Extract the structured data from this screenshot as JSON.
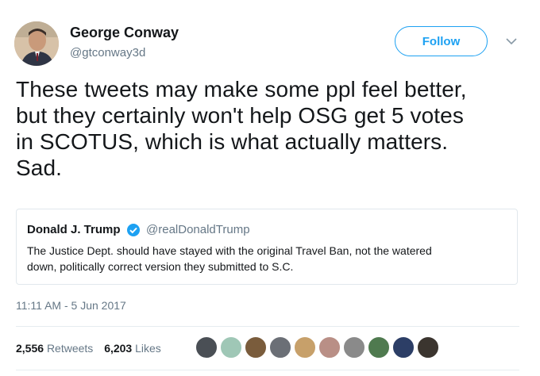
{
  "author": {
    "name": "George Conway",
    "handle": "@gtconway3d"
  },
  "follow_label": "Follow",
  "tweet": {
    "lines": [
      "These tweets may make some ppl feel better,",
      "but they certainly won't help OSG get 5 votes",
      "in SCOTUS, which is what actually matters.",
      "Sad."
    ]
  },
  "quoted": {
    "name": "Donald J. Trump",
    "handle": "@realDonaldTrump",
    "lines": [
      "The Justice Dept. should have stayed with the original Travel Ban, not the watered",
      "down, politically correct version they submitted to S.C."
    ]
  },
  "timestamp": "11:11 AM - 5 Jun 2017",
  "stats": {
    "retweets_count": "2,556",
    "retweets_label": "Retweets",
    "likes_count": "6,203",
    "likes_label": "Likes"
  },
  "colors": {
    "accent": "#1da1f2",
    "secondary_text": "#657786",
    "primary_text": "#14171a",
    "border": "#e1e8ed"
  }
}
